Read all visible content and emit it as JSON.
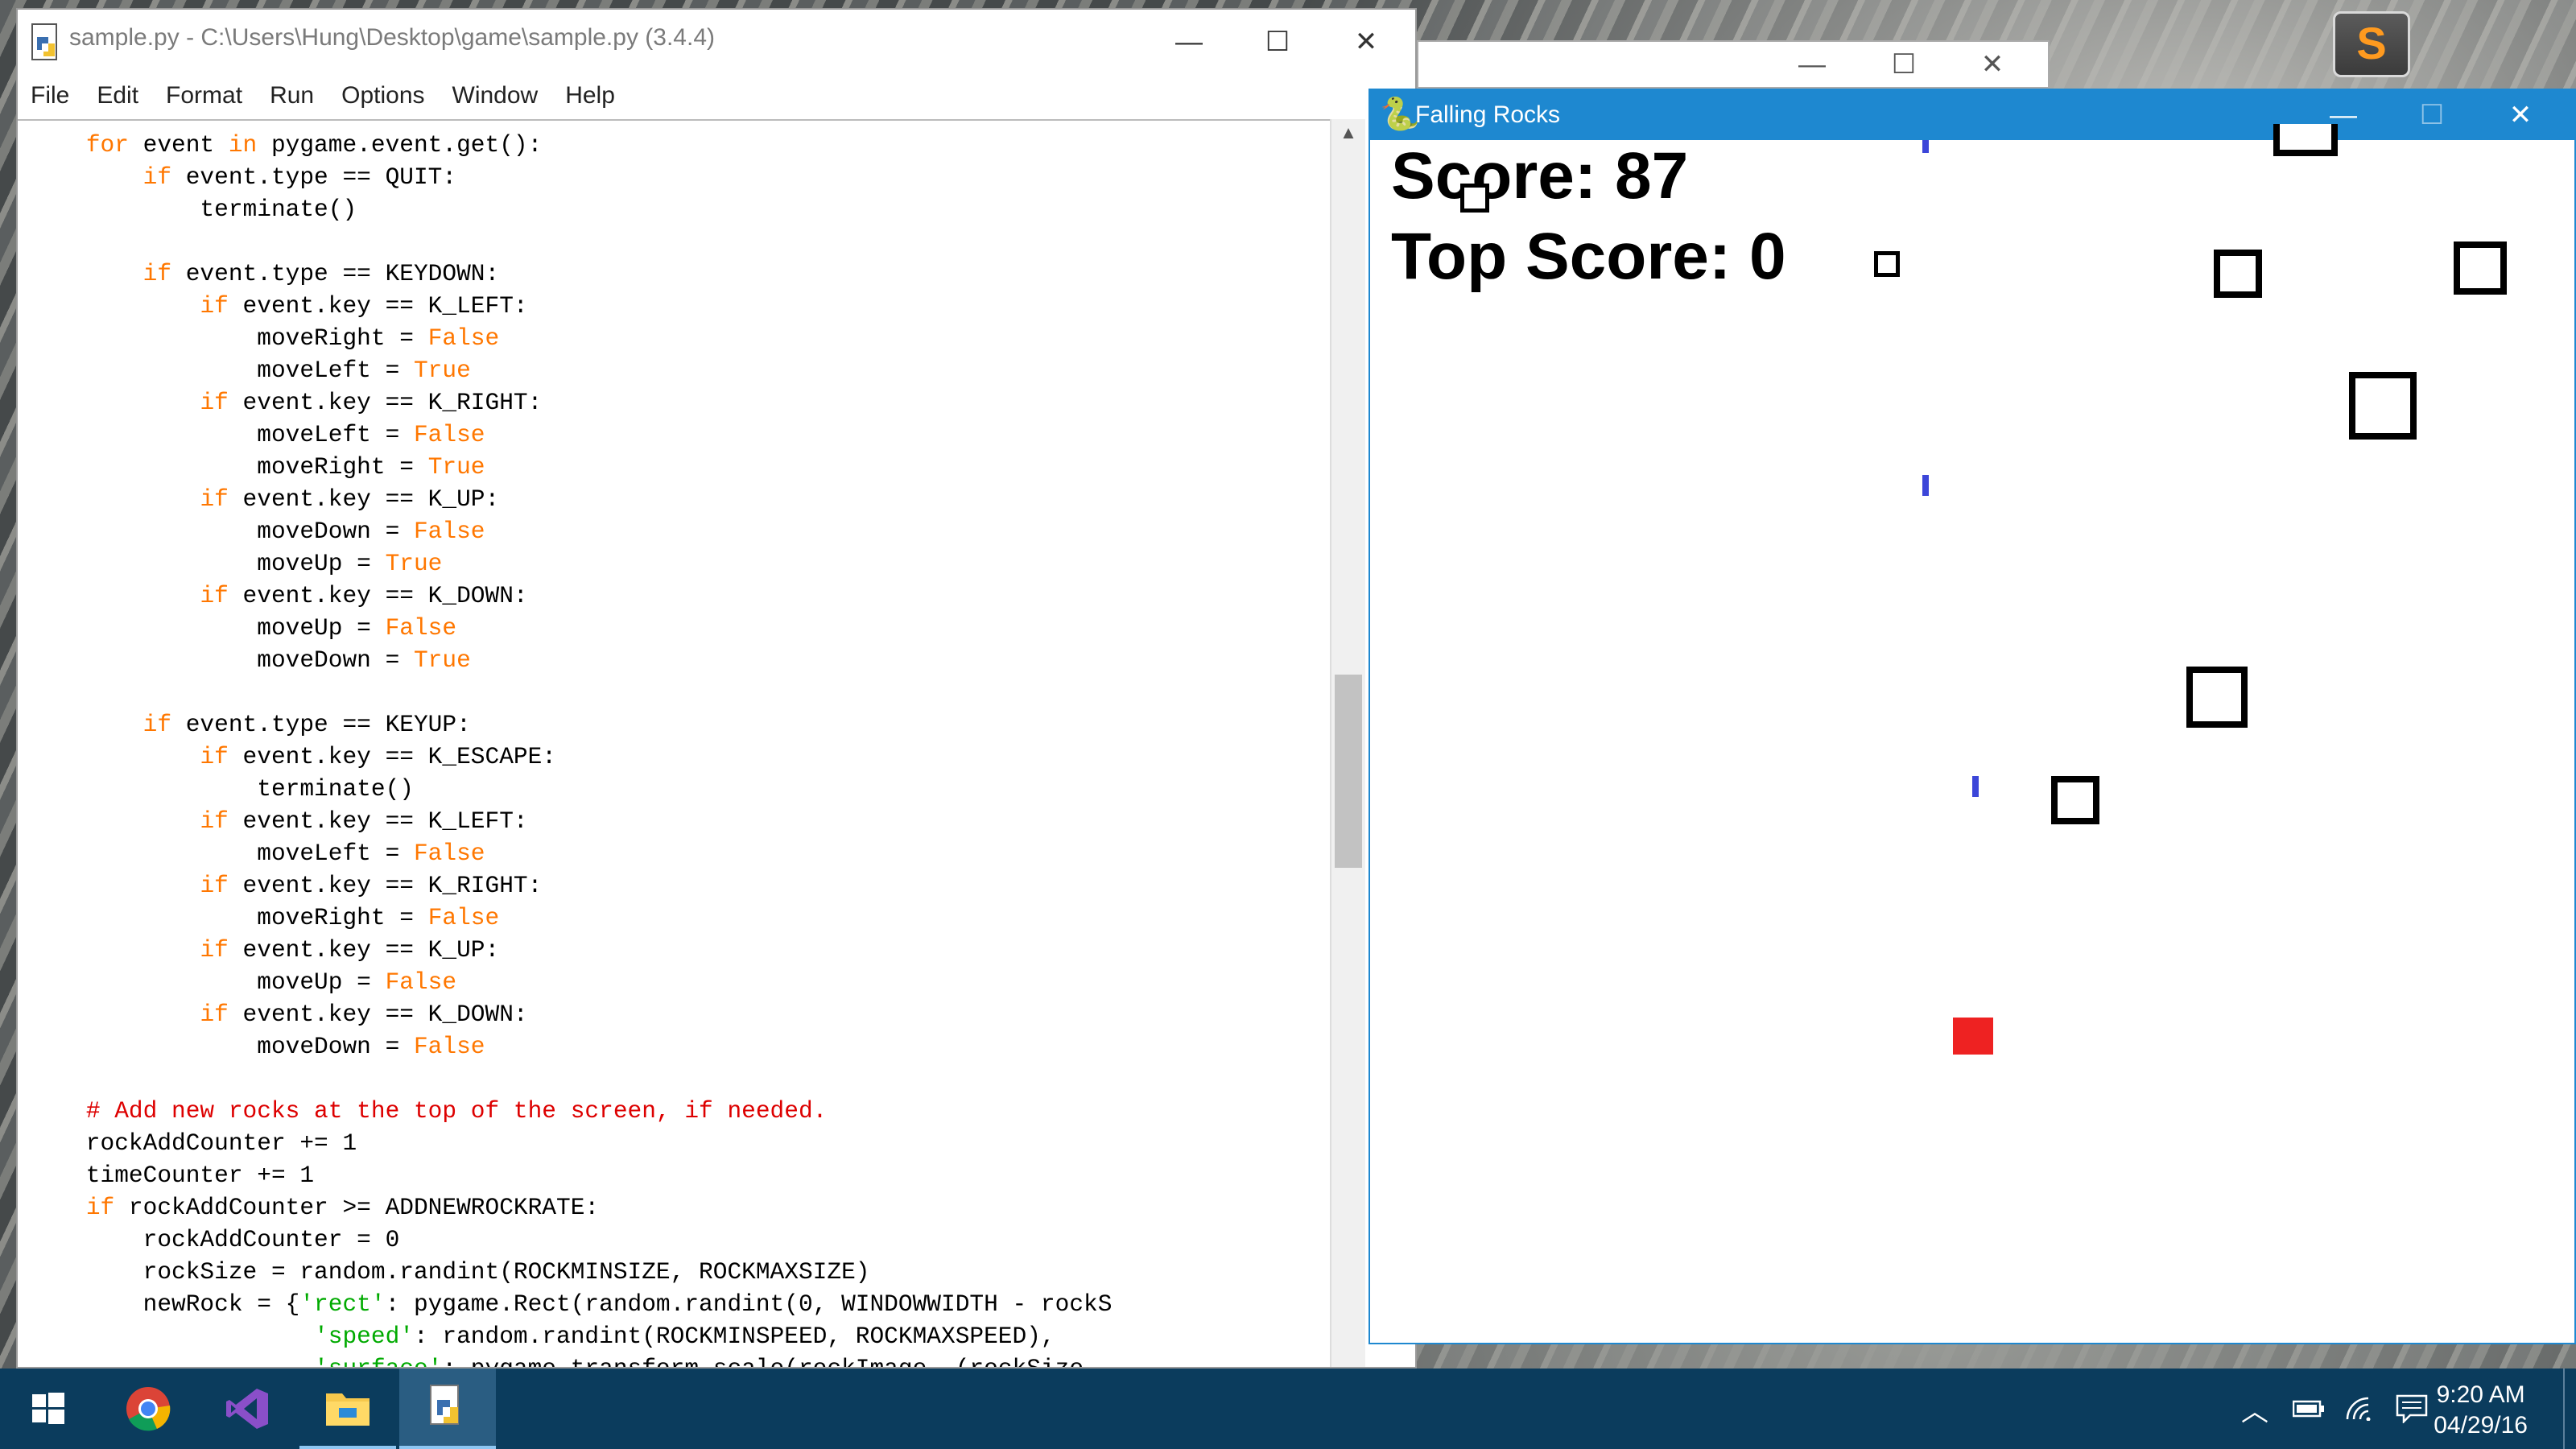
{
  "idle_window": {
    "title": "sample.py - C:\\Users\\Hung\\Desktop\\game\\sample.py (3.4.4)",
    "menu": [
      "File",
      "Edit",
      "Format",
      "Run",
      "Options",
      "Window",
      "Help"
    ],
    "controls": {
      "minimize": "—",
      "maximize": "☐",
      "close": "✕"
    },
    "code_lines": [
      [
        [
          "    ",
          ""
        ],
        [
          "for",
          "kw"
        ],
        [
          " event ",
          ""
        ],
        [
          "in",
          "kw"
        ],
        [
          " pygame.event.get():",
          ""
        ]
      ],
      [
        [
          "        ",
          ""
        ],
        [
          "if",
          "kw"
        ],
        [
          " event.type == QUIT:",
          ""
        ]
      ],
      [
        [
          "            terminate()",
          ""
        ]
      ],
      [
        [
          "",
          ""
        ]
      ],
      [
        [
          "        ",
          ""
        ],
        [
          "if",
          "kw"
        ],
        [
          " event.type == KEYDOWN:",
          ""
        ]
      ],
      [
        [
          "            ",
          ""
        ],
        [
          "if",
          "kw"
        ],
        [
          " event.key == K_LEFT:",
          ""
        ]
      ],
      [
        [
          "                moveRight = ",
          ""
        ],
        [
          "False",
          "kw"
        ]
      ],
      [
        [
          "                moveLeft = ",
          ""
        ],
        [
          "True",
          "kw"
        ]
      ],
      [
        [
          "            ",
          ""
        ],
        [
          "if",
          "kw"
        ],
        [
          " event.key == K_RIGHT:",
          ""
        ]
      ],
      [
        [
          "                moveLeft = ",
          ""
        ],
        [
          "False",
          "kw"
        ]
      ],
      [
        [
          "                moveRight = ",
          ""
        ],
        [
          "True",
          "kw"
        ]
      ],
      [
        [
          "            ",
          ""
        ],
        [
          "if",
          "kw"
        ],
        [
          " event.key == K_UP:",
          ""
        ]
      ],
      [
        [
          "                moveDown = ",
          ""
        ],
        [
          "False",
          "kw"
        ]
      ],
      [
        [
          "                moveUp = ",
          ""
        ],
        [
          "True",
          "kw"
        ]
      ],
      [
        [
          "            ",
          ""
        ],
        [
          "if",
          "kw"
        ],
        [
          " event.key == K_DOWN:",
          ""
        ]
      ],
      [
        [
          "                moveUp = ",
          ""
        ],
        [
          "False",
          "kw"
        ]
      ],
      [
        [
          "                moveDown = ",
          ""
        ],
        [
          "True",
          "kw"
        ]
      ],
      [
        [
          "",
          ""
        ]
      ],
      [
        [
          "        ",
          ""
        ],
        [
          "if",
          "kw"
        ],
        [
          " event.type == KEYUP:",
          ""
        ]
      ],
      [
        [
          "            ",
          ""
        ],
        [
          "if",
          "kw"
        ],
        [
          " event.key == K_ESCAPE:",
          ""
        ]
      ],
      [
        [
          "                terminate()",
          ""
        ]
      ],
      [
        [
          "            ",
          ""
        ],
        [
          "if",
          "kw"
        ],
        [
          " event.key == K_LEFT:",
          ""
        ]
      ],
      [
        [
          "                moveLeft = ",
          ""
        ],
        [
          "False",
          "kw"
        ]
      ],
      [
        [
          "            ",
          ""
        ],
        [
          "if",
          "kw"
        ],
        [
          " event.key == K_RIGHT:",
          ""
        ]
      ],
      [
        [
          "                moveRight = ",
          ""
        ],
        [
          "False",
          "kw"
        ]
      ],
      [
        [
          "            ",
          ""
        ],
        [
          "if",
          "kw"
        ],
        [
          " event.key == K_UP:",
          ""
        ]
      ],
      [
        [
          "                moveUp = ",
          ""
        ],
        [
          "False",
          "kw"
        ]
      ],
      [
        [
          "            ",
          ""
        ],
        [
          "if",
          "kw"
        ],
        [
          " event.key == K_DOWN:",
          ""
        ]
      ],
      [
        [
          "                moveDown = ",
          ""
        ],
        [
          "False",
          "kw"
        ]
      ],
      [
        [
          "",
          ""
        ]
      ],
      [
        [
          "    ",
          ""
        ],
        [
          "# Add new rocks at the top of the screen, if needed.",
          "cm"
        ]
      ],
      [
        [
          "    rockAddCounter += 1",
          ""
        ]
      ],
      [
        [
          "    timeCounter += 1",
          ""
        ]
      ],
      [
        [
          "    ",
          ""
        ],
        [
          "if",
          "kw"
        ],
        [
          " rockAddCounter >= ADDNEWROCKRATE:",
          ""
        ]
      ],
      [
        [
          "        rockAddCounter = 0",
          ""
        ]
      ],
      [
        [
          "        rockSize = random.randint(ROCKMINSIZE, ROCKMAXSIZE)",
          ""
        ]
      ],
      [
        [
          "        newRock = {",
          ""
        ],
        [
          "'rect'",
          "str"
        ],
        [
          ": pygame.Rect(random.randint(0, WINDOWWIDTH - rockS",
          ""
        ]
      ],
      [
        [
          "                    ",
          ""
        ],
        [
          "'speed'",
          "str"
        ],
        [
          ": random.randint(ROCKMINSPEED, ROCKMAXSPEED),",
          ""
        ]
      ],
      [
        [
          "                    ",
          ""
        ],
        [
          "'surface'",
          "str"
        ],
        [
          ": pygame.transform.scale(rockImage, (rockSize,",
          ""
        ]
      ]
    ]
  },
  "pygame_window": {
    "title": "Falling Rocks",
    "controls": {
      "minimize": "—",
      "maximize": "☐",
      "close": "✕"
    },
    "score_label": "Score: 87",
    "top_score_label": "Top Score: 0"
  },
  "background_window": {
    "controls": {
      "minimize": "—",
      "maximize": "☐",
      "close": "✕"
    }
  },
  "taskbar": {
    "apps": [
      "start",
      "chrome",
      "visual-studio",
      "file-explorer",
      "idle"
    ],
    "clock_time": "9:20 AM",
    "clock_date": "04/29/16"
  },
  "colors": {
    "taskbar": "#0b3c5d",
    "pygame_titlebar": "#1e88d0",
    "keyword": "#ff7700",
    "string": "#00aa00",
    "comment": "#dd0000",
    "player": "#ee2222",
    "laser": "#3c46d9"
  }
}
